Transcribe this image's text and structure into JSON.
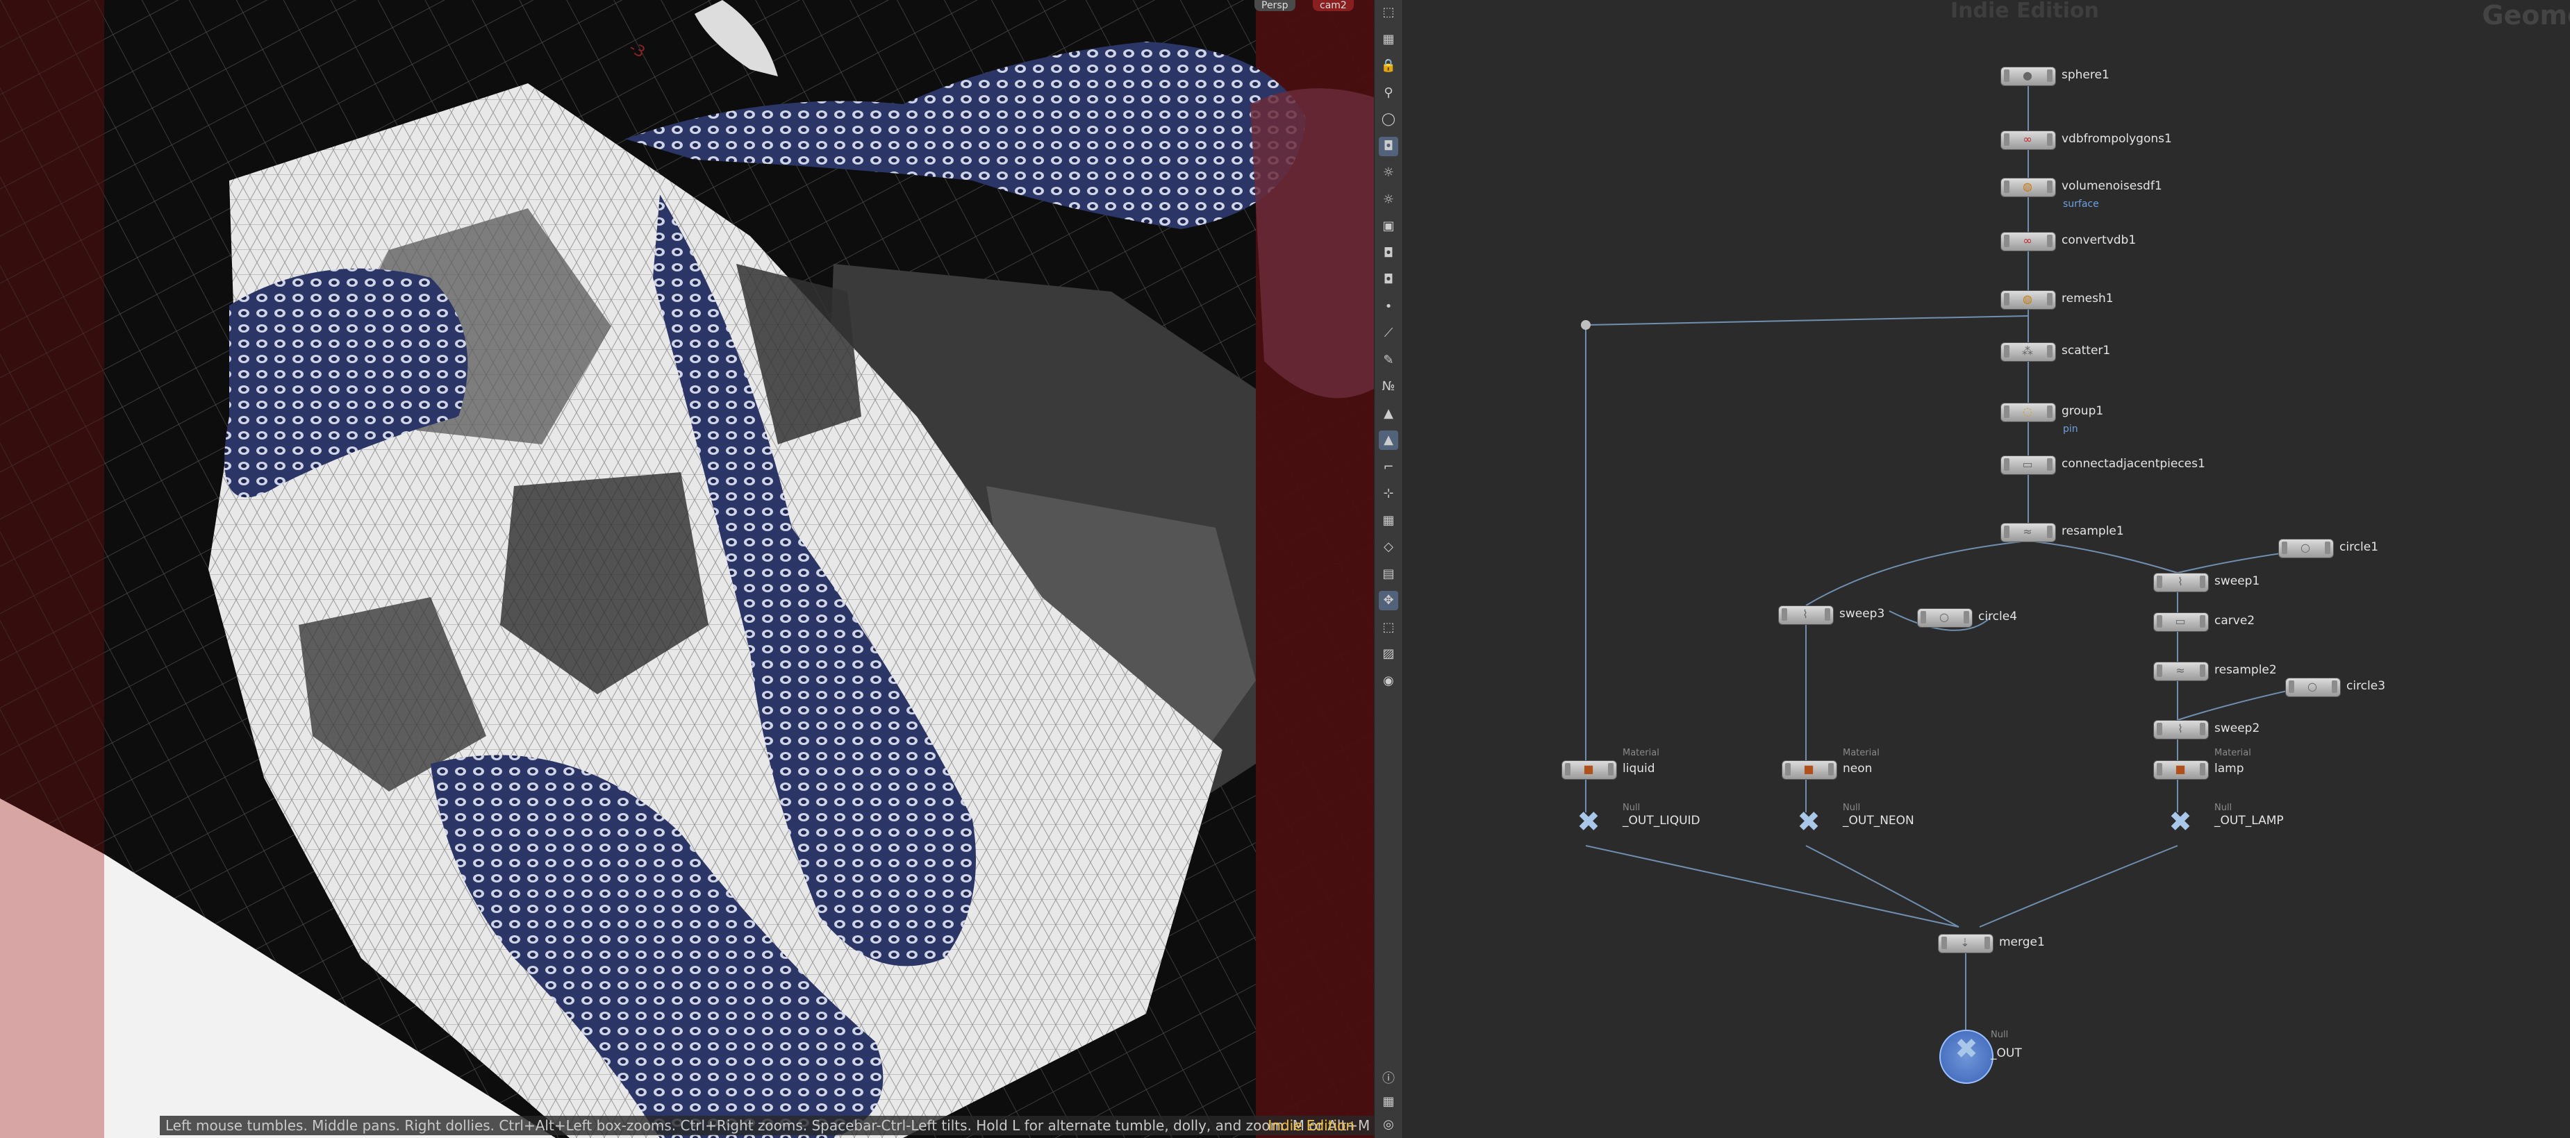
{
  "viewport": {
    "camera_menu": "Persp",
    "cam_menu": "cam2",
    "status_text": "Left mouse tumbles. Middle pans. Right dollies. Ctrl+Alt+Left box-zooms. Ctrl+Right zooms. Spacebar-Ctrl-Left tilts. Hold L for alternate tumble, dolly, and zoom.    M or Alt+M for First Person Navigation.",
    "edition_label": "Indie Edition",
    "axis_label": "-3"
  },
  "toolbar": {
    "icons": [
      "select-icon",
      "render-icon",
      "lock-icon",
      "pin-icon",
      "sphere-icon",
      "camera-icon",
      "light-icon",
      "light-icon",
      "display-icon",
      "camera-icon",
      "camera-icon",
      "point-icon",
      "edge-icon",
      "brush-icon",
      "number-icon",
      "paint-icon",
      "paint-icon",
      "ruler-icon",
      "snap-icon",
      "grid-icon",
      "shape-icon",
      "image-icon",
      "move-icon",
      "select-icon",
      "background-icon",
      "location-icon",
      "info-icon",
      "layout-icon",
      "eye-icon"
    ]
  },
  "network": {
    "edition_label": "Indie Edition",
    "context_label": "Geomet",
    "nodes": [
      {
        "name": "sphere1",
        "sub": "",
        "flag": ""
      },
      {
        "name": "vdbfrompolygons1",
        "sub": "",
        "flag": ""
      },
      {
        "name": "volumenoisesdf1",
        "sub": "",
        "flag": "surface"
      },
      {
        "name": "convertvdb1",
        "sub": "",
        "flag": ""
      },
      {
        "name": "remesh1",
        "sub": "",
        "flag": ""
      },
      {
        "name": "scatter1",
        "sub": "",
        "flag": ""
      },
      {
        "name": "group1",
        "sub": "",
        "flag": "pin"
      },
      {
        "name": "connectadjacentpieces1",
        "sub": "",
        "flag": ""
      },
      {
        "name": "resample1",
        "sub": "",
        "flag": ""
      },
      {
        "name": "circle1",
        "sub": "",
        "flag": ""
      },
      {
        "name": "sweep1",
        "sub": "",
        "flag": ""
      },
      {
        "name": "sweep3",
        "sub": "",
        "flag": ""
      },
      {
        "name": "circle4",
        "sub": "",
        "flag": ""
      },
      {
        "name": "carve2",
        "sub": "",
        "flag": ""
      },
      {
        "name": "resample2",
        "sub": "",
        "flag": ""
      },
      {
        "name": "circle3",
        "sub": "",
        "flag": ""
      },
      {
        "name": "sweep2",
        "sub": "",
        "flag": ""
      },
      {
        "name": "liquid",
        "sub": "Material",
        "flag": ""
      },
      {
        "name": "neon",
        "sub": "Material",
        "flag": ""
      },
      {
        "name": "lamp",
        "sub": "Material",
        "flag": ""
      },
      {
        "name": "_OUT_LIQUID",
        "sub": "Null",
        "flag": ""
      },
      {
        "name": "_OUT_NEON",
        "sub": "Null",
        "flag": ""
      },
      {
        "name": "_OUT_LAMP",
        "sub": "Null",
        "flag": ""
      },
      {
        "name": "merge1",
        "sub": "",
        "flag": ""
      },
      {
        "name": "_OUT",
        "sub": "Null",
        "flag": ""
      }
    ]
  }
}
